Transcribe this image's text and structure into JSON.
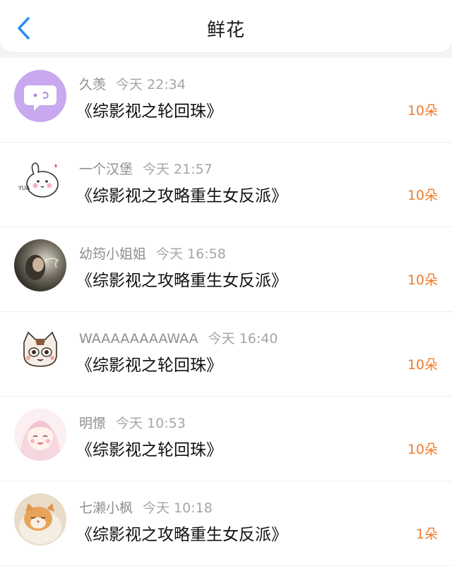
{
  "header": {
    "title": "鲜花",
    "back_icon": "chevron-left-icon",
    "accent_color": "#2f8cf2"
  },
  "rows": [
    {
      "name": "久羡",
      "time": "今天 22:34",
      "book": "《综影视之轮回珠》",
      "count": "10朵",
      "avatar": "chat-bubble-avatar"
    },
    {
      "name": "一个汉堡",
      "time": "今天 21:57",
      "book": "《综影视之攻略重生女反派》",
      "count": "10朵",
      "avatar": "bunny-avatar"
    },
    {
      "name": "幼筠小姐姐",
      "time": "今天 16:58",
      "book": "《综影视之攻略重生女反派》",
      "count": "10朵",
      "avatar": "photo-avatar"
    },
    {
      "name": "WAAAAAAAAWAA",
      "time": "今天 16:40",
      "book": "《综影视之轮回珠》",
      "count": "10朵",
      "avatar": "cat-avatar"
    },
    {
      "name": "明憬",
      "time": "今天 10:53",
      "book": "《综影视之轮回珠》",
      "count": "10朵",
      "avatar": "anime-girl-avatar"
    },
    {
      "name": "七濑小枫",
      "time": "今天 10:18",
      "book": "《综影视之攻略重生女反派》",
      "count": "1朵",
      "avatar": "cat-photo-avatar"
    }
  ],
  "colors": {
    "count": "#f07b2c",
    "meta": "#8e8e93"
  }
}
